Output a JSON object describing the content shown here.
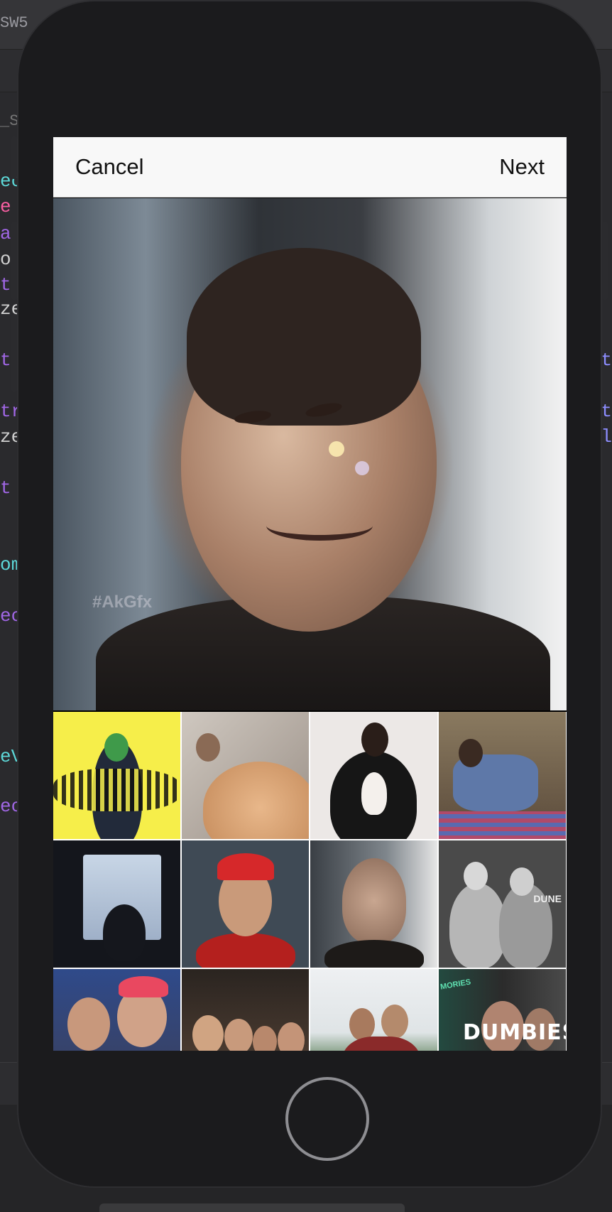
{
  "editor": {
    "tab_title": "SW5",
    "sub_title": "_SW",
    "code_left": [
      {
        "text": "ec",
        "color": "#5dd8d8"
      },
      {
        "text": " e",
        "color": "#fc5fa3"
      },
      {
        "text": "a",
        "color": "#a167e6"
      },
      {
        "text": "o",
        "color": "#d0d0d0"
      },
      {
        "text": "t",
        "color": "#a167e6"
      },
      {
        "text": "ze",
        "color": "#d0d0d0"
      },
      {
        "text": "t",
        "color": "#a167e6"
      },
      {
        "text": "tr",
        "color": "#a167e6"
      },
      {
        "text": "ze",
        "color": "#d0d0d0"
      },
      {
        "text": "t",
        "color": "#a167e6"
      },
      {
        "text": "om",
        "color": "#5dd8d8"
      },
      {
        "text": "ec",
        "color": "#a167e6"
      },
      {
        "text": "eV",
        "color": "#5dd8d8"
      },
      {
        "text": "ec",
        "color": "#a167e6"
      }
    ],
    "code_right": [
      "t",
      "t",
      "l"
    ]
  },
  "photo_picker": {
    "cancel_label": "Cancel",
    "next_label": "Next",
    "preview_watermark": "#AkGfx",
    "thumbnails": [
      {
        "label": "yellow-art-portrait"
      },
      {
        "label": "selfie-with-cat"
      },
      {
        "label": "holding-white-cat"
      },
      {
        "label": "sitting-on-chair-phone"
      },
      {
        "label": "window-silhouette"
      },
      {
        "label": "boy-red-cap"
      },
      {
        "label": "smiling-portrait"
      },
      {
        "label": "two-friends-bw",
        "caption": "DUNE"
      },
      {
        "label": "selfie-two-friends"
      },
      {
        "label": "group-selfie-night"
      },
      {
        "label": "friends-outdoor"
      },
      {
        "label": "dumbies-photo",
        "caption": "DUMBIES",
        "tag": "MORIES"
      }
    ]
  }
}
